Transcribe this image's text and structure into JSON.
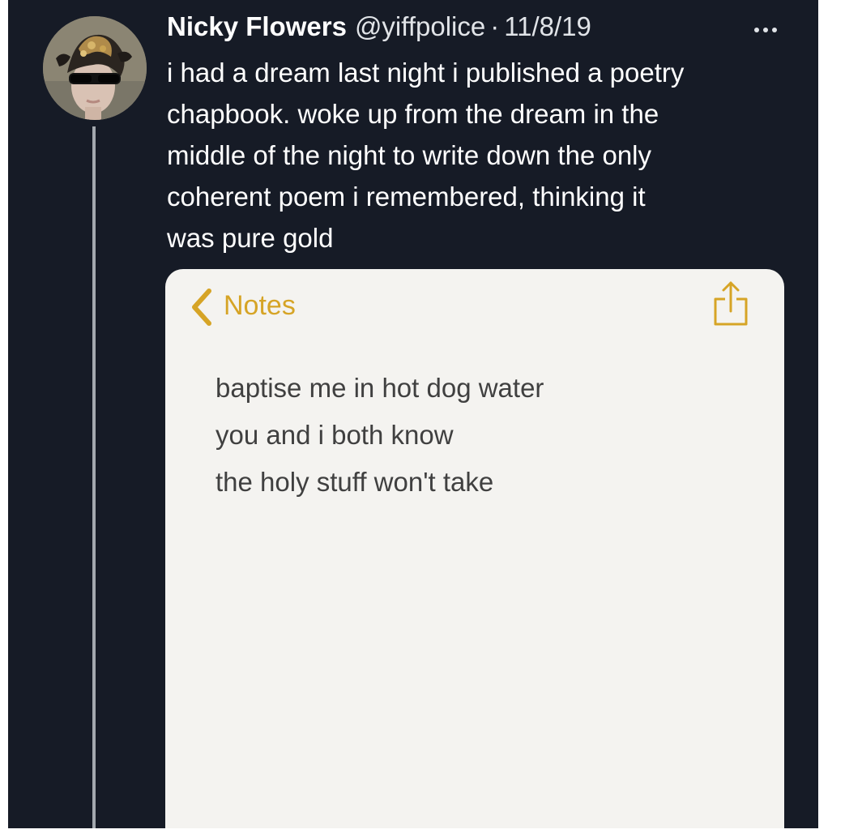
{
  "tweet": {
    "display_name": "Nicky Flowers",
    "handle": "@yiffpolice",
    "separator": "·",
    "date": "11/8/19",
    "text_lines": [
      "i had a dream last night i published a poetry",
      "chapbook. woke up from the dream in the",
      "middle of the night to write down the only",
      "coherent poem i remembered, thinking it",
      "was pure gold"
    ]
  },
  "notes": {
    "back_label": "Notes",
    "body_lines": [
      "baptise me in hot dog water",
      "you and i both know",
      "the holy stuff won't take"
    ]
  },
  "icons": {
    "more": "more-horizontal-icon",
    "back": "chevron-left-icon",
    "share": "share-icon"
  },
  "colors": {
    "background": "#161b26",
    "text": "#ffffff",
    "notes_accent": "#d6a426",
    "notes_paper": "#f4f3f0",
    "notes_text": "#404040"
  }
}
